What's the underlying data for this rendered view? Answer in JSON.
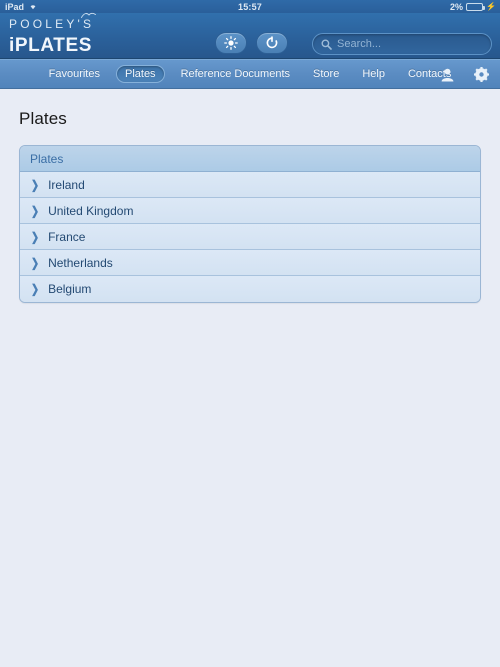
{
  "status_bar": {
    "device": "iPad",
    "wifi_icon": "wifi-icon",
    "time": "15:57",
    "battery_percent": "2%",
    "battery_icon": "battery-icon",
    "charging_icon": "charging-bolt-icon"
  },
  "header": {
    "logo_top": "POOLEY'S",
    "logo_bottom": "iPLATES",
    "buttons": [
      {
        "name": "brightness-button",
        "icon": "sun-icon"
      },
      {
        "name": "refresh-button",
        "icon": "refresh-icon"
      }
    ],
    "search": {
      "icon": "search-icon",
      "placeholder": "Search...",
      "value": ""
    }
  },
  "nav": {
    "items": [
      {
        "label": "Favourites",
        "active": false
      },
      {
        "label": "Plates",
        "active": true
      },
      {
        "label": "Reference Documents",
        "active": false
      },
      {
        "label": "Store",
        "active": false
      },
      {
        "label": "Help",
        "active": false
      },
      {
        "label": "Contacts",
        "active": false
      }
    ],
    "icons": [
      {
        "name": "user-account-icon"
      },
      {
        "name": "settings-gear-icon"
      }
    ]
  },
  "main": {
    "page_title": "Plates",
    "table": {
      "header": "Plates",
      "rows": [
        {
          "label": "Ireland",
          "disclosure": "chevron-right-icon"
        },
        {
          "label": "United Kingdom",
          "disclosure": "chevron-right-icon"
        },
        {
          "label": "France",
          "disclosure": "chevron-right-icon"
        },
        {
          "label": "Netherlands",
          "disclosure": "chevron-right-icon"
        },
        {
          "label": "Belgium",
          "disclosure": "chevron-right-icon"
        }
      ]
    }
  },
  "colors": {
    "header_blue": "#2b619b",
    "nav_blue": "#5b8cc2",
    "content_bg": "#e8ecf5",
    "row_bg": "#d8e5f4",
    "accent_text": "#3a6ea5"
  }
}
